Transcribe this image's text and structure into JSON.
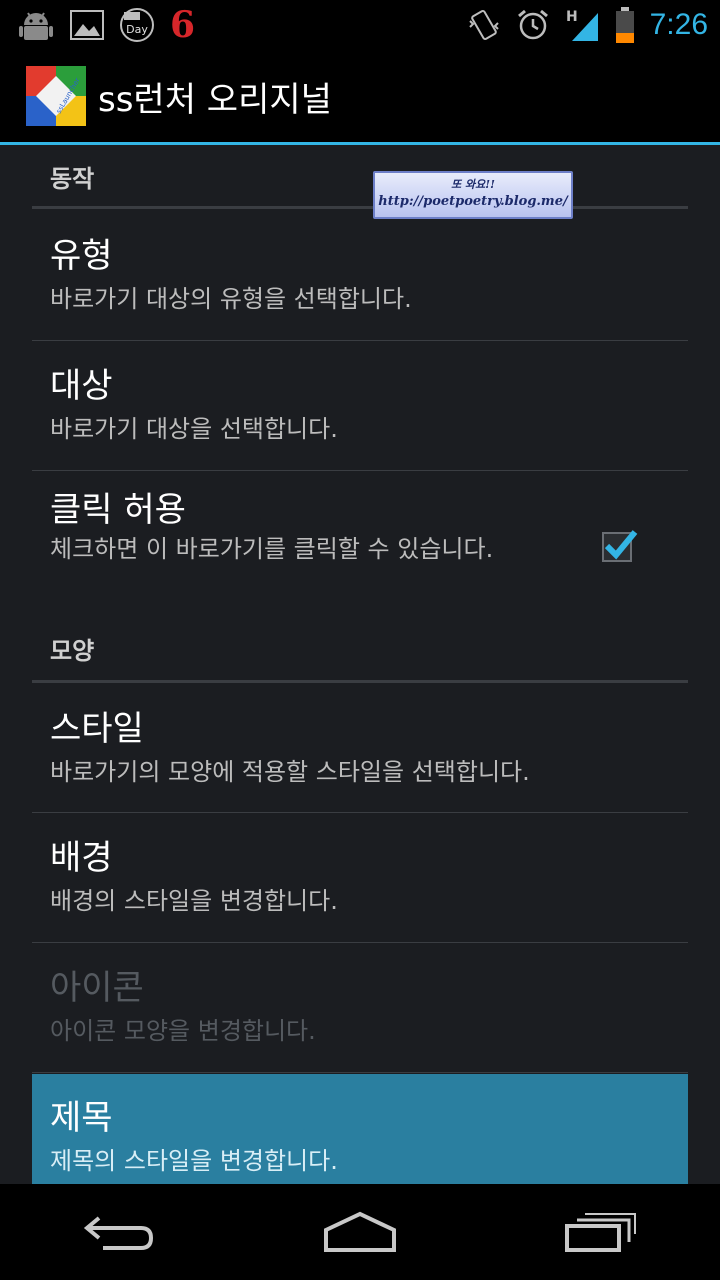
{
  "status_bar": {
    "left_icons": [
      "android-icon",
      "gallery-icon",
      "calendar-icon"
    ],
    "calendar_label": "Day",
    "notification_number": "6",
    "right_icons": [
      "vibrate-icon",
      "alarm-icon",
      "signal-icon",
      "battery-icon"
    ],
    "network_label": "H",
    "time": "7:26"
  },
  "action_bar": {
    "app_title": "ss런처 오리지널",
    "app_icon_text": "ssLauncher"
  },
  "overlay": {
    "line1": "또 와요!!",
    "line2": "http://poetpoetry.blog.me/"
  },
  "sections": [
    {
      "header": "동작",
      "items": [
        {
          "title": "유형",
          "summary": "바로가기 대상의 유형을 선택합니다."
        },
        {
          "title": "대상",
          "summary": "바로가기 대상을 선택합니다."
        },
        {
          "title": "클릭 허용",
          "summary": "체크하면 이 바로가기를 클릭할 수 있습니다.",
          "checked": true
        }
      ]
    },
    {
      "header": "모양",
      "items": [
        {
          "title": "스타일",
          "summary": "바로가기의 모양에 적용할 스타일을 선택합니다."
        },
        {
          "title": "배경",
          "summary": "배경의 스타일을 변경합니다."
        },
        {
          "title": "아이콘",
          "summary": "아이콘 모양을 변경합니다.",
          "enabled": false
        },
        {
          "title": "제목",
          "summary": "제목의 스타일을 변경합니다.",
          "selected": true
        }
      ]
    }
  ],
  "colors": {
    "accent": "#33b5e5",
    "selected_row": "#2a7fa0",
    "notification_number": "#d6262a",
    "battery_low": "#ff8800"
  },
  "nav_bar": [
    "back-icon",
    "home-icon",
    "recents-icon"
  ]
}
